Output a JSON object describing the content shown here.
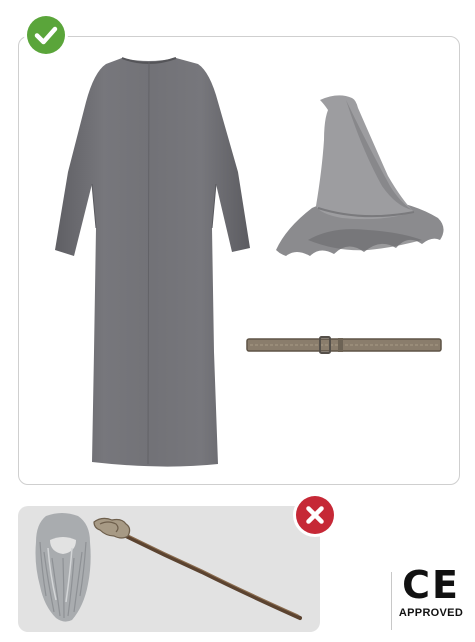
{
  "included": {
    "items": [
      {
        "icon": "robe-icon"
      },
      {
        "icon": "wizard-hat-icon"
      },
      {
        "icon": "belt-icon"
      }
    ]
  },
  "excluded": {
    "items": [
      {
        "icon": "beard-wig-icon"
      },
      {
        "icon": "wizard-staff-icon"
      }
    ]
  },
  "badges": {
    "included_icon": "checkmark-icon",
    "included_color": "#5aa53a",
    "excluded_icon": "cross-icon",
    "excluded_color": "#c62836"
  },
  "certification": {
    "logo": "CE",
    "caption": "APPROVED"
  }
}
